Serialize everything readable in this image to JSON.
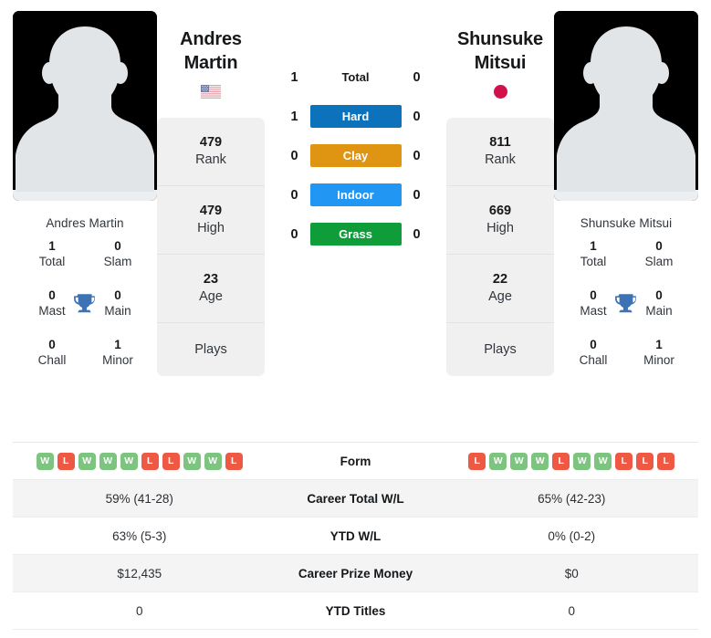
{
  "players": {
    "left": {
      "first_name": "Andres",
      "last_name": "Martin",
      "full_name": "Andres Martin",
      "flag_icon": "us-flag-icon",
      "flag_country": "United States",
      "titles": {
        "total_value": "1",
        "total_label": "Total",
        "slam_value": "0",
        "slam_label": "Slam",
        "mast_value": "0",
        "mast_label": "Mast",
        "main_value": "0",
        "main_label": "Main",
        "chall_value": "0",
        "chall_label": "Chall",
        "minor_value": "1",
        "minor_label": "Minor"
      },
      "rank_value": "479",
      "rank_label": "Rank",
      "high_value": "479",
      "high_label": "High",
      "age_value": "23",
      "age_label": "Age",
      "plays_value": "",
      "plays_label": "Plays"
    },
    "right": {
      "first_name": "Shunsuke",
      "last_name": "Mitsui",
      "full_name": "Shunsuke Mitsui",
      "flag_icon": "jp-flag-icon",
      "flag_country": "Japan",
      "titles": {
        "total_value": "1",
        "total_label": "Total",
        "slam_value": "0",
        "slam_label": "Slam",
        "mast_value": "0",
        "mast_label": "Mast",
        "main_value": "0",
        "main_label": "Main",
        "chall_value": "0",
        "chall_label": "Chall",
        "minor_value": "1",
        "minor_label": "Minor"
      },
      "rank_value": "811",
      "rank_label": "Rank",
      "high_value": "669",
      "high_label": "High",
      "age_value": "22",
      "age_label": "Age",
      "plays_value": "",
      "plays_label": "Plays"
    }
  },
  "head_to_head": [
    {
      "label": "Total",
      "left": "1",
      "right": "0",
      "style": "plain",
      "color": ""
    },
    {
      "label": "Hard",
      "left": "1",
      "right": "0",
      "style": "badge",
      "color": "#0d72bc"
    },
    {
      "label": "Clay",
      "left": "0",
      "right": "0",
      "style": "badge",
      "color": "#e09512"
    },
    {
      "label": "Indoor",
      "left": "0",
      "right": "0",
      "style": "badge",
      "color": "#2196f3"
    },
    {
      "label": "Grass",
      "left": "0",
      "right": "0",
      "style": "badge",
      "color": "#0f9d3a"
    }
  ],
  "comparison_table": {
    "form": {
      "label": "Form",
      "left": [
        "W",
        "L",
        "W",
        "W",
        "W",
        "L",
        "L",
        "W",
        "W",
        "L"
      ],
      "right": [
        "L",
        "W",
        "W",
        "W",
        "L",
        "W",
        "W",
        "L",
        "L",
        "L"
      ]
    },
    "rows": [
      {
        "label": "Career Total W/L",
        "left": "59% (41-28)",
        "right": "65% (42-23)"
      },
      {
        "label": "YTD W/L",
        "left": "63% (5-3)",
        "right": "0% (0-2)"
      },
      {
        "label": "Career Prize Money",
        "left": "$12,435",
        "right": "$0"
      },
      {
        "label": "YTD Titles",
        "left": "0",
        "right": "0"
      }
    ]
  },
  "colors": {
    "win": "#7cc47f",
    "loss": "#ef5843",
    "trophy": "#3d72b4",
    "card_bg": "#f0f0f0",
    "row_alt": "#f4f4f4"
  }
}
